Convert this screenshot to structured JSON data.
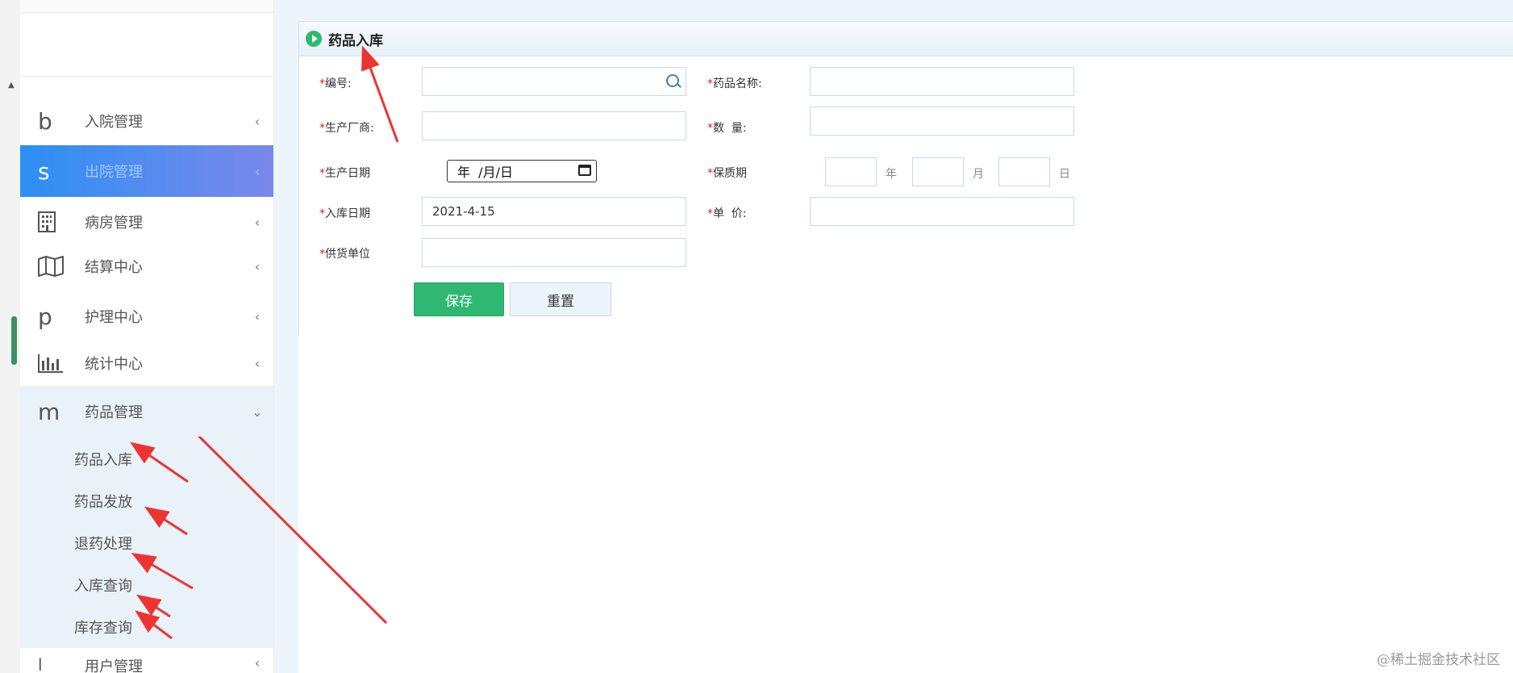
{
  "sidebar": {
    "menu": [
      {
        "icon": "b",
        "label": "入院管理",
        "chevron": "‹"
      },
      {
        "icon": "s",
        "label": "出院管理",
        "chevron": "‹"
      },
      {
        "icon": "",
        "label": "病房管理",
        "chevron": "‹"
      },
      {
        "icon": "",
        "label": "结算中心",
        "chevron": "‹"
      },
      {
        "icon": "p",
        "label": "护理中心",
        "chevron": "‹"
      },
      {
        "icon": "",
        "label": "统计中心",
        "chevron": "‹"
      },
      {
        "icon": "m",
        "label": "药品管理",
        "chevron": "⌄"
      }
    ],
    "submenu": [
      "药品入库",
      "药品发放",
      "退药处理",
      "入库查询",
      "库存查询"
    ],
    "partial_label": "用户管理"
  },
  "panel": {
    "title": "药品入库",
    "required_mark": "*",
    "fields": {
      "code_label": "编号:",
      "drug_name_label": "药品名称:",
      "manufacturer_label": "生产厂商:",
      "quantity_label": "数  量:",
      "production_date_label": "生产日期",
      "production_date_value": "年  /月/日",
      "shelf_life_label": "保质期",
      "unit_year": "年",
      "unit_month": "月",
      "unit_day": "日",
      "stock_date_label": "入库日期",
      "stock_date_value": "2021-4-15",
      "unit_price_label": "单  价:",
      "supplier_label": "供货单位"
    },
    "buttons": {
      "save": "保存",
      "reset": "重置"
    }
  },
  "watermark": "@稀土掘金技术社区",
  "colors": {
    "accent_green": "#2eb872",
    "active_menu_start": "#2c8ff5",
    "active_menu_end": "#7b88ea",
    "arrow_red": "#ee3333"
  }
}
